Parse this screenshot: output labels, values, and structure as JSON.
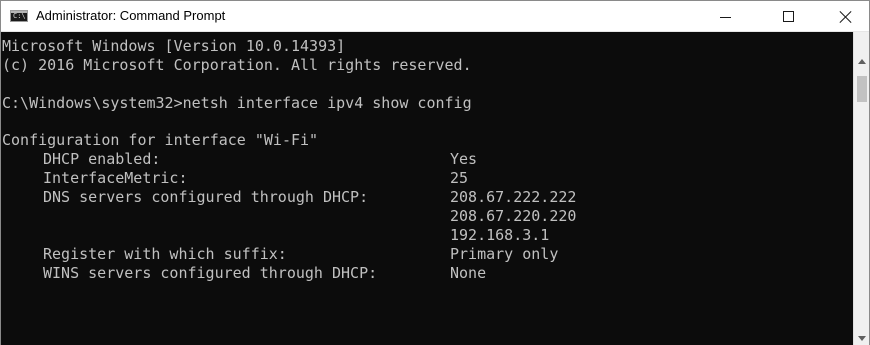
{
  "window": {
    "title": "Administrator: Command Prompt",
    "icon": "command-prompt-icon",
    "controls": [
      "minimize",
      "maximize",
      "close"
    ]
  },
  "console": {
    "header": [
      "Microsoft Windows [Version 10.0.14393]",
      "(c) 2016 Microsoft Corporation. All rights reserved."
    ],
    "command": "C:\\Windows\\system32>netsh interface ipv4 show config",
    "section_title": "Configuration for interface \"Wi-Fi\"",
    "config": [
      {
        "key": "DHCP enabled:",
        "value": "Yes"
      },
      {
        "key": "InterfaceMetric:",
        "value": "25"
      },
      {
        "key": "DNS servers configured through DHCP:",
        "value": "208.67.222.222"
      },
      {
        "key": "",
        "value": "208.67.220.220"
      },
      {
        "key": "",
        "value": "192.168.3.1"
      },
      {
        "key": "Register with which suffix:",
        "value": "Primary only"
      },
      {
        "key": "WINS servers configured through DHCP:",
        "value": "None"
      }
    ]
  },
  "colors": {
    "console_bg": "#0c0c0c",
    "console_text": "#c0c0c0",
    "titlebar_bg": "#ffffff"
  }
}
